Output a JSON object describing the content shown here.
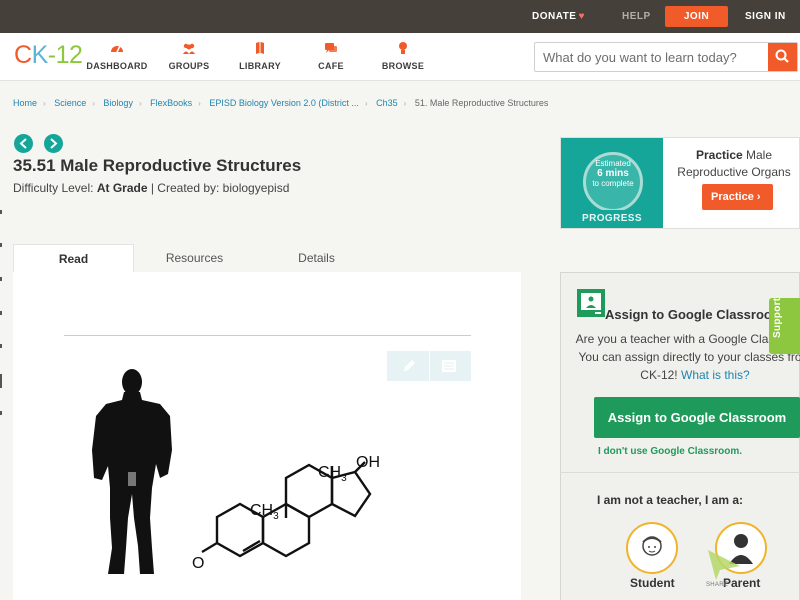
{
  "topbar": {
    "donate": "DONATE",
    "help": "HELP",
    "join": "JOIN",
    "signin": "SIGN IN"
  },
  "nav": {
    "logo": {
      "c": "C",
      "k": "K",
      "dash": "-",
      "n": "12"
    },
    "items": [
      {
        "label": "DASHBOARD",
        "icon": "dashboard-icon"
      },
      {
        "label": "GROUPS",
        "icon": "groups-icon"
      },
      {
        "label": "LIBRARY",
        "icon": "library-icon"
      },
      {
        "label": "CAFE",
        "icon": "cafe-icon"
      },
      {
        "label": "BROWSE",
        "icon": "browse-icon"
      }
    ],
    "search_placeholder": "What do you want to learn today?"
  },
  "breadcrumb": [
    "Home",
    "Science",
    "Biology",
    "FlexBooks",
    "EPISD Biology Version 2.0 (District ...",
    "Ch35",
    "51. Male Reproductive Structures"
  ],
  "page": {
    "title": "35.51 Male Reproductive Structures",
    "difficulty_label": "Difficulty Level:",
    "difficulty_value": "At Grade",
    "created_by": "| Created by: biologyepisd"
  },
  "tabs": [
    "Read",
    "Resources",
    "Details"
  ],
  "figure": {
    "methyl_top": "CH",
    "methyl_top_sub": "3",
    "methyl_mid": "CH",
    "methyl_mid_sub": "3",
    "hydroxyl": "OH",
    "oxygen": "O"
  },
  "practice": {
    "estimated": "Estimated",
    "mins": "6 mins",
    "to_complete": "to complete",
    "progress": "PROGRESS",
    "title_bold": "Practice",
    "title_rest": "Male Reproductive Organs",
    "button": "Practice"
  },
  "classroom": {
    "heading": "Assign to Google Classroom",
    "text": "Are you a teacher with a Google Classroom? You can assign directly to your classes from CK-12!",
    "question": "What is this?",
    "button": "Assign to Google Classroom",
    "dont_use": "I don't use Google Classroom.",
    "role_prompt": "I am not a teacher, I am a:",
    "roles": [
      "Student",
      "Parent"
    ]
  },
  "support": "Support",
  "share": "SHARE",
  "colors": {
    "brand_orange": "#f15a29",
    "teal": "#16a599",
    "green": "#1e9b5a",
    "link_blue": "#1f85b1",
    "support_green": "#8dc63f"
  }
}
